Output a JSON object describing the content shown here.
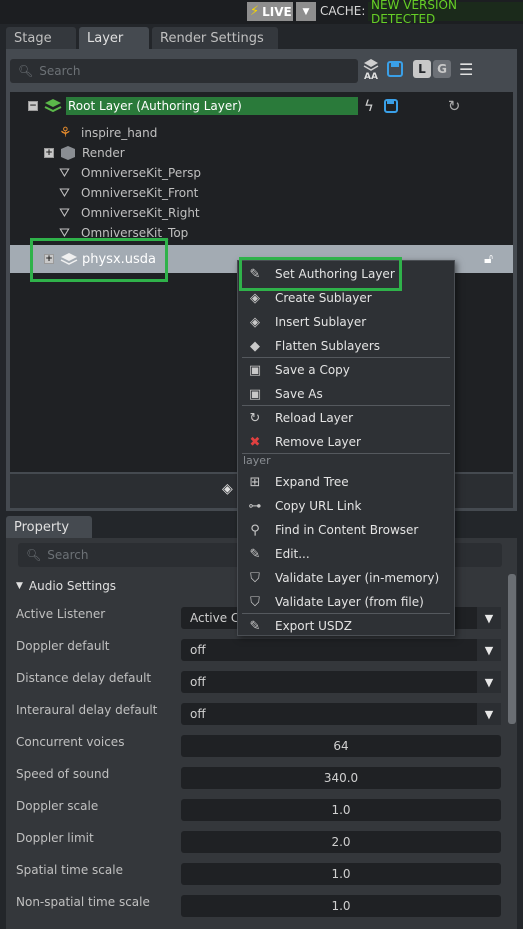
{
  "topbar": {
    "live_label": "LIVE",
    "cache_label": "CACHE:",
    "cache_status": "NEW VERSION DETECTED"
  },
  "tabs": [
    {
      "label": "Stage"
    },
    {
      "label": "Layer"
    },
    {
      "label": "Render Settings"
    }
  ],
  "layer_panel": {
    "search_placeholder": "Search",
    "aa_label": "AA",
    "l_label": "L",
    "g_label": "G",
    "root_layer": "Root Layer (Authoring Layer)",
    "tree_items": [
      {
        "label": "inspire_hand"
      },
      {
        "label": "Render"
      },
      {
        "label": "OmniverseKit_Persp"
      },
      {
        "label": "OmniverseKit_Front"
      },
      {
        "label": "OmniverseKit_Right"
      },
      {
        "label": "OmniverseKit_Top"
      }
    ],
    "sublayer": "physx.usda"
  },
  "context_menu": {
    "items": [
      {
        "label": "Set Authoring Layer",
        "icon": "pencil-icon"
      },
      {
        "label": "Create Sublayer",
        "icon": "layers-plus-icon"
      },
      {
        "label": "Insert Sublayer",
        "icon": "layers-insert-icon"
      },
      {
        "label": "Flatten Sublayers",
        "icon": "flatten-icon"
      },
      {
        "label": "Save a Copy",
        "icon": "save-icon"
      },
      {
        "label": "Save As",
        "icon": "save-icon"
      },
      {
        "label": "Reload Layer",
        "icon": "reload-icon"
      },
      {
        "label": "Remove Layer",
        "icon": "remove-icon"
      },
      {
        "label": "Expand Tree",
        "icon": "expand-icon"
      },
      {
        "label": "Copy URL Link",
        "icon": "link-icon"
      },
      {
        "label": "Find in Content Browser",
        "icon": "search-icon"
      },
      {
        "label": "Edit...",
        "icon": "pencil-icon"
      },
      {
        "label": "Validate Layer (in-memory)",
        "icon": "shield-icon"
      },
      {
        "label": "Validate Layer (from file)",
        "icon": "shield-icon"
      },
      {
        "label": "Export USDZ",
        "icon": "pencil-icon"
      }
    ],
    "section_label": "layer"
  },
  "property_panel": {
    "tab": "Property",
    "search_placeholder": "Search",
    "section": "Audio Settings",
    "rows": [
      {
        "label": "Active Listener",
        "value": "Active C"
      },
      {
        "label": "Doppler default",
        "value": "off"
      },
      {
        "label": "Distance delay default",
        "value": "off"
      },
      {
        "label": "Interaural delay default",
        "value": "off"
      },
      {
        "label": "Concurrent voices",
        "value": "64"
      },
      {
        "label": "Speed of sound",
        "value": "340.0"
      },
      {
        "label": "Doppler scale",
        "value": "1.0"
      },
      {
        "label": "Doppler limit",
        "value": "2.0"
      },
      {
        "label": "Spatial time scale",
        "value": "1.0"
      },
      {
        "label": "Non-spatial time scale",
        "value": "1.0"
      }
    ]
  }
}
